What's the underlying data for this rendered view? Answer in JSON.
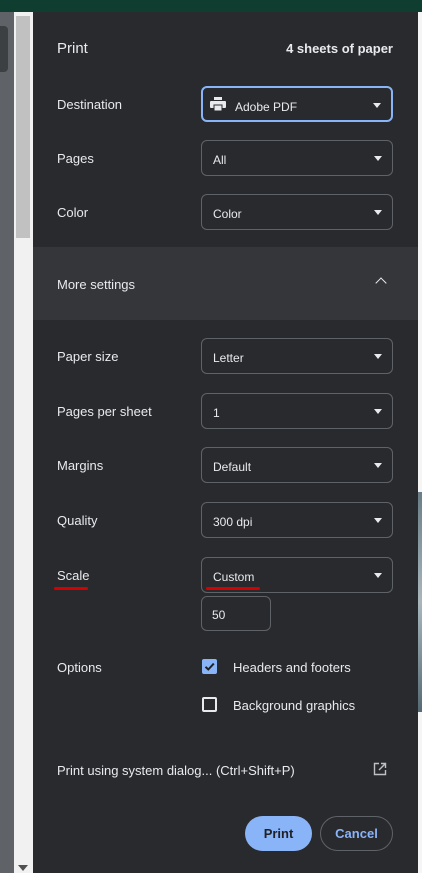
{
  "dialog": {
    "title": "Print",
    "sheets": "4 sheets of paper"
  },
  "destination": {
    "label": "Destination",
    "value": "Adobe PDF",
    "icon": "printer-icon"
  },
  "pages": {
    "label": "Pages",
    "value": "All"
  },
  "color": {
    "label": "Color",
    "value": "Color"
  },
  "more_settings": {
    "label": "More settings",
    "expanded": true
  },
  "paper_size": {
    "label": "Paper size",
    "value": "Letter"
  },
  "pages_per_sheet": {
    "label": "Pages per sheet",
    "value": "1"
  },
  "margins": {
    "label": "Margins",
    "value": "Default"
  },
  "quality": {
    "label": "Quality",
    "value": "300 dpi"
  },
  "scale": {
    "label": "Scale",
    "value": "Custom",
    "custom_value": "50",
    "annotation_color": "#d60000"
  },
  "options": {
    "label": "Options",
    "headers_footers": {
      "label": "Headers and footers",
      "checked": true
    },
    "background_graphics": {
      "label": "Background graphics",
      "checked": false
    }
  },
  "system_dialog": {
    "label": "Print using system dialog... (Ctrl+Shift+P)",
    "icon": "open-external-icon"
  },
  "buttons": {
    "print": "Print",
    "cancel": "Cancel"
  },
  "colors": {
    "accent": "#8ab4f8",
    "panel": "#292a2d",
    "text": "#e8eaed"
  }
}
